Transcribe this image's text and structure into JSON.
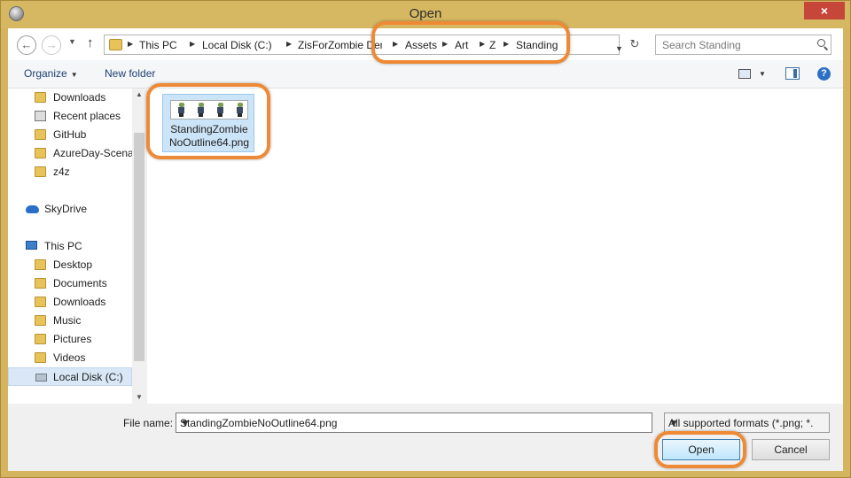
{
  "window": {
    "title": "Open",
    "close_label": "×"
  },
  "address_bar": {
    "crumbs": [
      "This PC",
      "Local Disk (C:)",
      "ZisForZombie Dem",
      "Assets",
      "Art",
      "Z",
      "Standing"
    ]
  },
  "search": {
    "placeholder": "Search Standing"
  },
  "toolbar": {
    "organize_label": "Organize",
    "new_folder_label": "New folder",
    "help_label": "?"
  },
  "navigation": {
    "favorites": [
      "Downloads",
      "Recent places",
      "GitHub",
      "AzureDay-Scenar",
      "z4z"
    ],
    "skydrive": "SkyDrive",
    "this_pc": "This PC",
    "pc_items": [
      "Desktop",
      "Documents",
      "Downloads",
      "Music",
      "Pictures",
      "Videos",
      "Local Disk (C:)"
    ]
  },
  "files": [
    {
      "name_line1": "StandingZombie",
      "name_line2": "NoOutline64.png",
      "selected": true
    }
  ],
  "bottom": {
    "file_name_label": "File name:",
    "file_name_value": "StandingZombieNoOutline64.png",
    "filter_value": "All supported formats (*.png; *.",
    "open_label": "Open",
    "cancel_label": "Cancel"
  },
  "colors": {
    "frame": "#d4b45f",
    "highlight": "#ee8a35",
    "selection": "#cce4f7",
    "accent": "#2c6fc5"
  }
}
